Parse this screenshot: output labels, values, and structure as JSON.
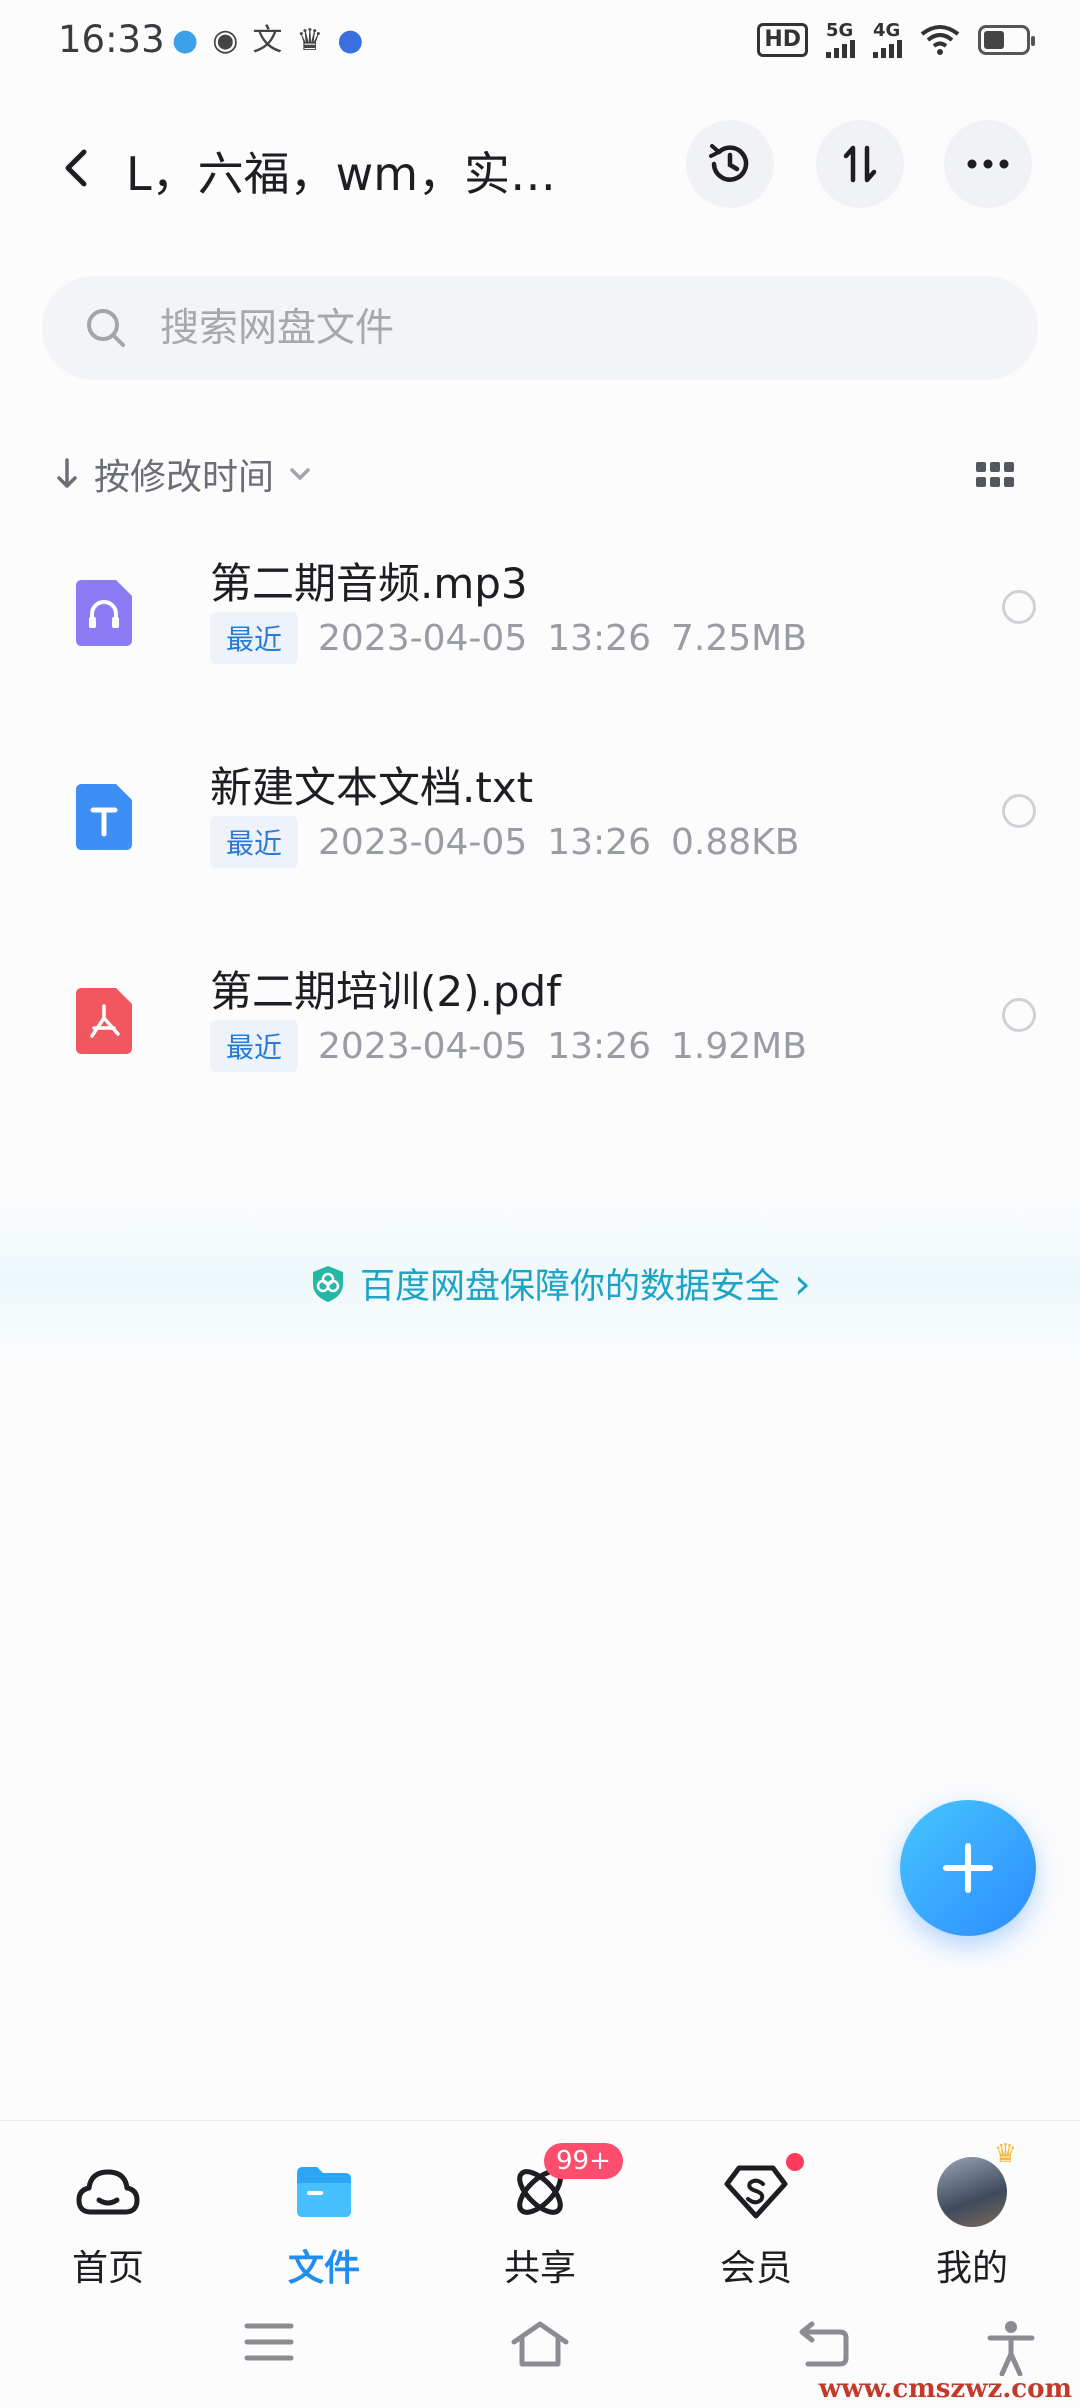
{
  "status_bar": {
    "time": "16:33",
    "hd": "HD",
    "sim1_label": "5G",
    "sim2_label": "4G"
  },
  "header": {
    "title": "L，六福，wm，实…"
  },
  "search": {
    "placeholder": "搜索网盘文件"
  },
  "sort": {
    "label": "按修改时间"
  },
  "files": [
    {
      "name": "第二期音频.mp3",
      "tag": "最近",
      "date": "2023-04-05",
      "time": "13:26",
      "size": "7.25MB",
      "icon": "audio-file-icon",
      "color": "#8b7cf6"
    },
    {
      "name": "新建文本文档.txt",
      "tag": "最近",
      "date": "2023-04-05",
      "time": "13:26",
      "size": "0.88KB",
      "icon": "text-file-icon",
      "color": "#3d8ef5"
    },
    {
      "name": "第二期培训(2).pdf",
      "tag": "最近",
      "date": "2023-04-05",
      "time": "13:26",
      "size": "1.92MB",
      "icon": "pdf-file-icon",
      "color": "#f0575f"
    }
  ],
  "promo": {
    "text": "百度网盘保障你的数据安全",
    "arrow": "›"
  },
  "bottom_nav": {
    "items": [
      {
        "label": "首页",
        "icon": "cloud-home-icon"
      },
      {
        "label": "文件",
        "icon": "folder-icon"
      },
      {
        "label": "共享",
        "icon": "share-atom-icon",
        "badge": "99+"
      },
      {
        "label": "会员",
        "icon": "vip-diamond-icon"
      },
      {
        "label": "我的",
        "icon": "avatar"
      }
    ],
    "active_index": 1
  },
  "watermark": "www.cmszwz.com",
  "colors": {
    "accent": "#1f8ef1",
    "badge_red": "#ff4d6d",
    "promo_text": "#1ba4c8"
  }
}
